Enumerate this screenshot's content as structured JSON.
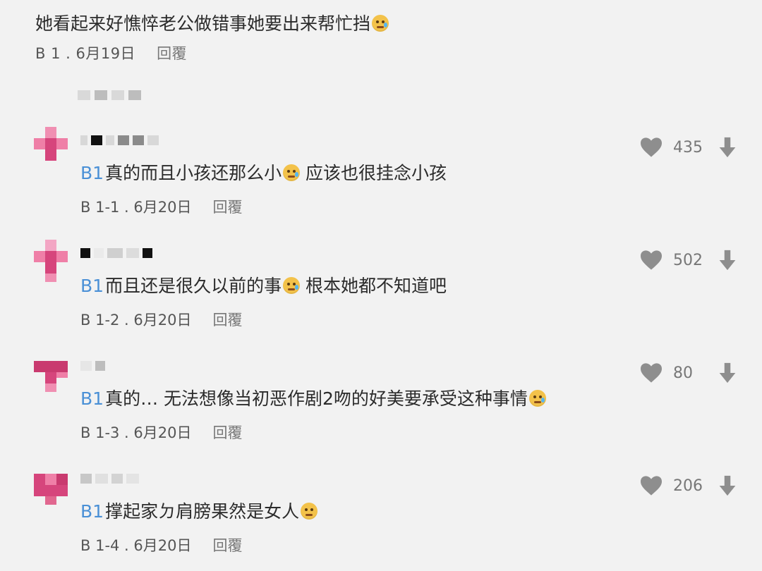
{
  "top_comment": {
    "text": "她看起来好憔悴老公做错事她要出来帮忙挡",
    "floor": "B 1 . 6月19日",
    "reply": "回覆"
  },
  "replies": [
    {
      "mention": "B1",
      "text_a": "真的而且小孩还那么小",
      "text_b": "应该也很挂念小孩",
      "floor": "B 1-1 . 6月20日",
      "reply": "回覆",
      "likes": "435"
    },
    {
      "mention": "B1",
      "text_a": "而且还是很久以前的事",
      "text_b": "根本她都不知道吧",
      "floor": "B 1-2 . 6月20日",
      "reply": "回覆",
      "likes": "502"
    },
    {
      "mention": "B1",
      "text_a": "真的… 无法想像当初恶作剧2吻的好美要承受这种事情",
      "text_b": "",
      "floor": "B 1-3 . 6月20日",
      "reply": "回覆",
      "likes": "80"
    },
    {
      "mention": "B1",
      "text_a": "撑起家ㄉ肩膀果然是女人",
      "text_b": "",
      "floor": "B 1-4 . 6月20日",
      "reply": "回覆",
      "likes": "206"
    }
  ],
  "colors": {
    "background": "#f2f2f2",
    "mention": "#4a90d6",
    "avatar": "#d6457c",
    "icon": "#8e8e8e"
  },
  "icons": [
    "heart-icon",
    "downvote-icon",
    "crying-face-emoji"
  ]
}
